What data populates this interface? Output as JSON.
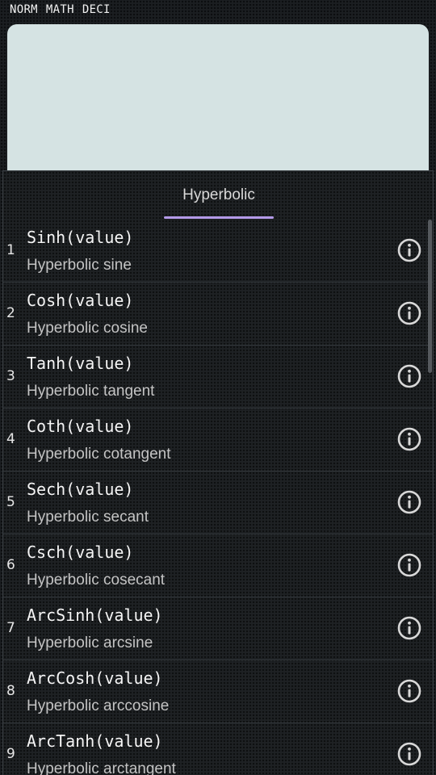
{
  "status_bar": {
    "mode": "NORM",
    "input": "MATH",
    "format": "DECI"
  },
  "display": {
    "expression": ""
  },
  "tabs": [
    {
      "label": "Hyperbolic",
      "selected": true
    }
  ],
  "accent_color": "#b49ae8",
  "functions": [
    {
      "number": "1",
      "name": "Sinh(value)",
      "description": "Hyperbolic sine",
      "icon": "info-icon"
    },
    {
      "number": "2",
      "name": "Cosh(value)",
      "description": "Hyperbolic cosine",
      "icon": "info-icon"
    },
    {
      "number": "3",
      "name": "Tanh(value)",
      "description": "Hyperbolic tangent",
      "icon": "info-icon"
    },
    {
      "number": "4",
      "name": "Coth(value)",
      "description": "Hyperbolic cotangent",
      "icon": "info-icon"
    },
    {
      "number": "5",
      "name": "Sech(value)",
      "description": "Hyperbolic secant",
      "icon": "info-icon"
    },
    {
      "number": "6",
      "name": "Csch(value)",
      "description": "Hyperbolic cosecant",
      "icon": "info-icon"
    },
    {
      "number": "7",
      "name": "ArcSinh(value)",
      "description": "Hyperbolic arcsine",
      "icon": "info-icon"
    },
    {
      "number": "8",
      "name": "ArcCosh(value)",
      "description": "Hyperbolic arccosine",
      "icon": "info-icon"
    },
    {
      "number": "9",
      "name": "ArcTanh(value)",
      "description": "Hyperbolic arctangent",
      "icon": "info-icon"
    }
  ]
}
